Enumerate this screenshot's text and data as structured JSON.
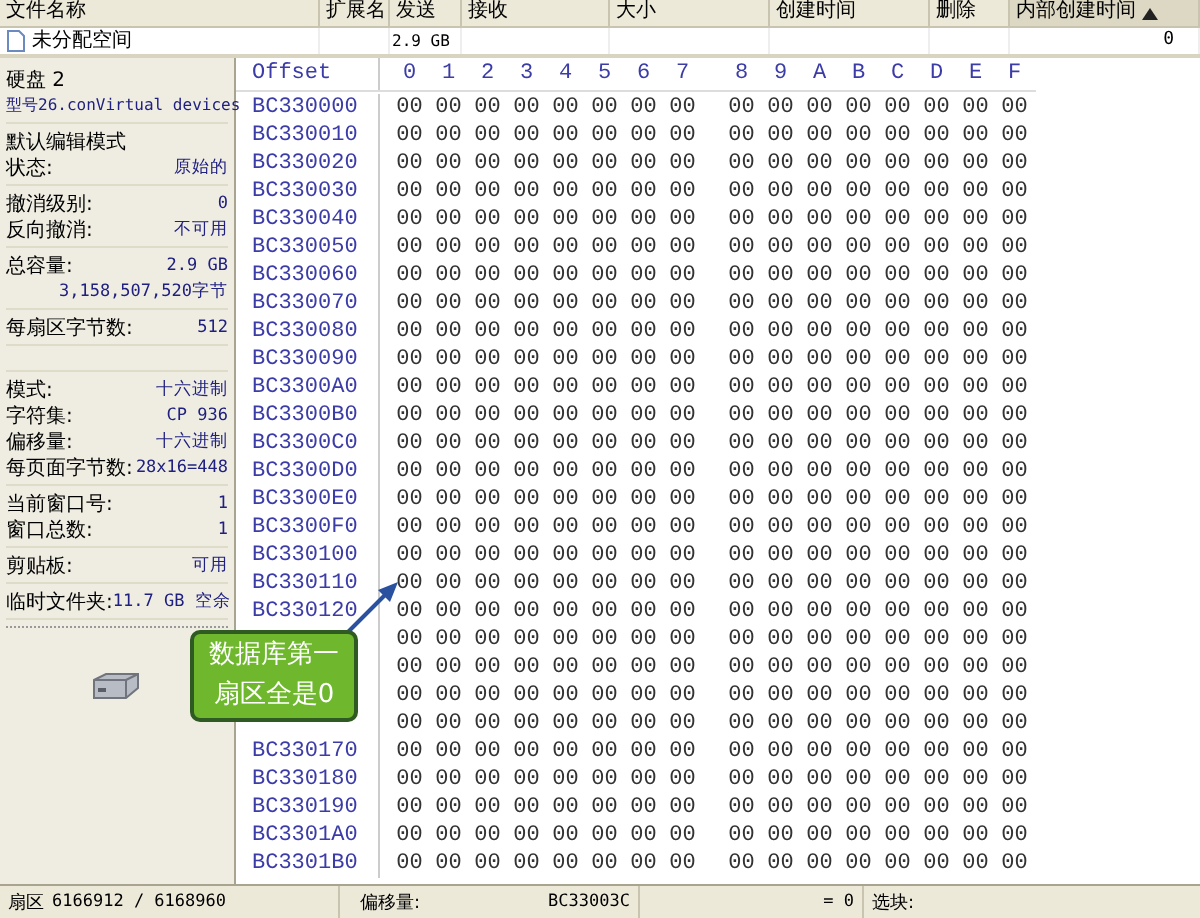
{
  "file_list": {
    "columns": [
      {
        "label": "文件名称",
        "sorted": false
      },
      {
        "label": "扩展名",
        "sorted": false
      },
      {
        "label": "发送",
        "sorted": false
      },
      {
        "label": "接收",
        "sorted": false
      },
      {
        "label": "大小",
        "sorted": false
      },
      {
        "label": "创建时间",
        "sorted": false
      },
      {
        "label": "删除",
        "sorted": false
      },
      {
        "label": "内部创建时间",
        "sorted": true
      }
    ],
    "rows": [
      {
        "cells": [
          "未分配空间",
          "",
          "2.9 GB",
          "",
          "",
          "",
          "",
          "0"
        ]
      }
    ]
  },
  "info_panel": {
    "sections": [
      {
        "rows": [
          {
            "kind": "text",
            "text": "硬盘 2"
          },
          {
            "kind": "text",
            "text": "型号26.conVirtual devices"
          }
        ]
      },
      {
        "rows": [
          {
            "kind": "text",
            "text": "默认编辑模式"
          },
          {
            "kind": "pair",
            "label": "状态:",
            "value": "原始的"
          }
        ]
      },
      {
        "rows": [
          {
            "kind": "pair",
            "label": "撤消级别:",
            "value": "0"
          },
          {
            "kind": "pair",
            "label": "反向撤消:",
            "value": "不可用"
          }
        ]
      },
      {
        "rows": [
          {
            "kind": "pair",
            "label": "总容量:",
            "value": "2.9 GB"
          },
          {
            "kind": "value",
            "value": "3,158,507,520字节"
          }
        ]
      },
      {
        "rows": [
          {
            "kind": "pair",
            "label": "每扇区字节数:",
            "value": "512"
          }
        ]
      },
      {
        "rows": [
          {
            "kind": "pair",
            "label": "模式:",
            "value": "十六进制"
          },
          {
            "kind": "pair",
            "label": "字符集:",
            "value": "CP 936"
          },
          {
            "kind": "pair",
            "label": "偏移量:",
            "value": "十六进制"
          },
          {
            "kind": "pair",
            "label": "每页面字节数:",
            "value": "28x16=448"
          }
        ]
      },
      {
        "rows": [
          {
            "kind": "pair",
            "label": "当前窗口号:",
            "value": "1"
          },
          {
            "kind": "pair",
            "label": "窗口总数:",
            "value": "1"
          }
        ]
      },
      {
        "rows": [
          {
            "kind": "pair",
            "label": "剪贴板:",
            "value": "可用"
          }
        ]
      },
      {
        "rows": [
          {
            "kind": "pair",
            "label": "临时文件夹:",
            "value": "11.7 GB 空余"
          }
        ]
      }
    ]
  },
  "hex_view": {
    "offset_header": "Offset",
    "column_headers": [
      "0",
      "1",
      "2",
      "3",
      "4",
      "5",
      "6",
      "7",
      "8",
      "9",
      "A",
      "B",
      "C",
      "D",
      "E",
      "F"
    ],
    "rows": [
      {
        "offset": "BC330000",
        "bytes": [
          "00",
          "00",
          "00",
          "00",
          "00",
          "00",
          "00",
          "00",
          "00",
          "00",
          "00",
          "00",
          "00",
          "00",
          "00",
          "00"
        ]
      },
      {
        "offset": "BC330010",
        "bytes": [
          "00",
          "00",
          "00",
          "00",
          "00",
          "00",
          "00",
          "00",
          "00",
          "00",
          "00",
          "00",
          "00",
          "00",
          "00",
          "00"
        ]
      },
      {
        "offset": "BC330020",
        "bytes": [
          "00",
          "00",
          "00",
          "00",
          "00",
          "00",
          "00",
          "00",
          "00",
          "00",
          "00",
          "00",
          "00",
          "00",
          "00",
          "00"
        ]
      },
      {
        "offset": "BC330030",
        "bytes": [
          "00",
          "00",
          "00",
          "00",
          "00",
          "00",
          "00",
          "00",
          "00",
          "00",
          "00",
          "00",
          "00",
          "00",
          "00",
          "00"
        ]
      },
      {
        "offset": "BC330040",
        "bytes": [
          "00",
          "00",
          "00",
          "00",
          "00",
          "00",
          "00",
          "00",
          "00",
          "00",
          "00",
          "00",
          "00",
          "00",
          "00",
          "00"
        ]
      },
      {
        "offset": "BC330050",
        "bytes": [
          "00",
          "00",
          "00",
          "00",
          "00",
          "00",
          "00",
          "00",
          "00",
          "00",
          "00",
          "00",
          "00",
          "00",
          "00",
          "00"
        ]
      },
      {
        "offset": "BC330060",
        "bytes": [
          "00",
          "00",
          "00",
          "00",
          "00",
          "00",
          "00",
          "00",
          "00",
          "00",
          "00",
          "00",
          "00",
          "00",
          "00",
          "00"
        ]
      },
      {
        "offset": "BC330070",
        "bytes": [
          "00",
          "00",
          "00",
          "00",
          "00",
          "00",
          "00",
          "00",
          "00",
          "00",
          "00",
          "00",
          "00",
          "00",
          "00",
          "00"
        ]
      },
      {
        "offset": "BC330080",
        "bytes": [
          "00",
          "00",
          "00",
          "00",
          "00",
          "00",
          "00",
          "00",
          "00",
          "00",
          "00",
          "00",
          "00",
          "00",
          "00",
          "00"
        ]
      },
      {
        "offset": "BC330090",
        "bytes": [
          "00",
          "00",
          "00",
          "00",
          "00",
          "00",
          "00",
          "00",
          "00",
          "00",
          "00",
          "00",
          "00",
          "00",
          "00",
          "00"
        ]
      },
      {
        "offset": "BC3300A0",
        "bytes": [
          "00",
          "00",
          "00",
          "00",
          "00",
          "00",
          "00",
          "00",
          "00",
          "00",
          "00",
          "00",
          "00",
          "00",
          "00",
          "00"
        ]
      },
      {
        "offset": "BC3300B0",
        "bytes": [
          "00",
          "00",
          "00",
          "00",
          "00",
          "00",
          "00",
          "00",
          "00",
          "00",
          "00",
          "00",
          "00",
          "00",
          "00",
          "00"
        ]
      },
      {
        "offset": "BC3300C0",
        "bytes": [
          "00",
          "00",
          "00",
          "00",
          "00",
          "00",
          "00",
          "00",
          "00",
          "00",
          "00",
          "00",
          "00",
          "00",
          "00",
          "00"
        ]
      },
      {
        "offset": "BC3300D0",
        "bytes": [
          "00",
          "00",
          "00",
          "00",
          "00",
          "00",
          "00",
          "00",
          "00",
          "00",
          "00",
          "00",
          "00",
          "00",
          "00",
          "00"
        ]
      },
      {
        "offset": "BC3300E0",
        "bytes": [
          "00",
          "00",
          "00",
          "00",
          "00",
          "00",
          "00",
          "00",
          "00",
          "00",
          "00",
          "00",
          "00",
          "00",
          "00",
          "00"
        ]
      },
      {
        "offset": "BC3300F0",
        "bytes": [
          "00",
          "00",
          "00",
          "00",
          "00",
          "00",
          "00",
          "00",
          "00",
          "00",
          "00",
          "00",
          "00",
          "00",
          "00",
          "00"
        ]
      },
      {
        "offset": "BC330100",
        "bytes": [
          "00",
          "00",
          "00",
          "00",
          "00",
          "00",
          "00",
          "00",
          "00",
          "00",
          "00",
          "00",
          "00",
          "00",
          "00",
          "00"
        ]
      },
      {
        "offset": "BC330110",
        "bytes": [
          "00",
          "00",
          "00",
          "00",
          "00",
          "00",
          "00",
          "00",
          "00",
          "00",
          "00",
          "00",
          "00",
          "00",
          "00",
          "00"
        ]
      },
      {
        "offset": "BC330120",
        "bytes": [
          "00",
          "00",
          "00",
          "00",
          "00",
          "00",
          "00",
          "00",
          "00",
          "00",
          "00",
          "00",
          "00",
          "00",
          "00",
          "00"
        ]
      },
      {
        "bytes": [
          "00",
          "00",
          "00",
          "00",
          "00",
          "00",
          "00",
          "00",
          "00",
          "00",
          "00",
          "00",
          "00",
          "00",
          "00",
          "00"
        ]
      },
      {
        "bytes": [
          "00",
          "00",
          "00",
          "00",
          "00",
          "00",
          "00",
          "00",
          "00",
          "00",
          "00",
          "00",
          "00",
          "00",
          "00",
          "00"
        ]
      },
      {
        "bytes": [
          "00",
          "00",
          "00",
          "00",
          "00",
          "00",
          "00",
          "00",
          "00",
          "00",
          "00",
          "00",
          "00",
          "00",
          "00",
          "00"
        ]
      },
      {
        "bytes": [
          "00",
          "00",
          "00",
          "00",
          "00",
          "00",
          "00",
          "00",
          "00",
          "00",
          "00",
          "00",
          "00",
          "00",
          "00",
          "00"
        ]
      },
      {
        "offset": "BC330170",
        "bytes": [
          "00",
          "00",
          "00",
          "00",
          "00",
          "00",
          "00",
          "00",
          "00",
          "00",
          "00",
          "00",
          "00",
          "00",
          "00",
          "00"
        ]
      },
      {
        "offset": "BC330180",
        "bytes": [
          "00",
          "00",
          "00",
          "00",
          "00",
          "00",
          "00",
          "00",
          "00",
          "00",
          "00",
          "00",
          "00",
          "00",
          "00",
          "00"
        ]
      },
      {
        "offset": "BC330190",
        "bytes": [
          "00",
          "00",
          "00",
          "00",
          "00",
          "00",
          "00",
          "00",
          "00",
          "00",
          "00",
          "00",
          "00",
          "00",
          "00",
          "00"
        ]
      },
      {
        "offset": "BC3301A0",
        "bytes": [
          "00",
          "00",
          "00",
          "00",
          "00",
          "00",
          "00",
          "00",
          "00",
          "00",
          "00",
          "00",
          "00",
          "00",
          "00",
          "00"
        ]
      },
      {
        "offset": "BC3301B0",
        "bytes": [
          "00",
          "00",
          "00",
          "00",
          "00",
          "00",
          "00",
          "00",
          "00",
          "00",
          "00",
          "00",
          "00",
          "00",
          "00",
          "00"
        ]
      }
    ]
  },
  "callout": {
    "text": "数据库第一扇区全是0"
  },
  "status_bar": {
    "sector_label": "扇区",
    "sector_value": "6166912 / 6168960",
    "offset_label": "偏移量:",
    "offset_value": "BC33003C",
    "equals": "= 0",
    "block_label": "选块:"
  }
}
